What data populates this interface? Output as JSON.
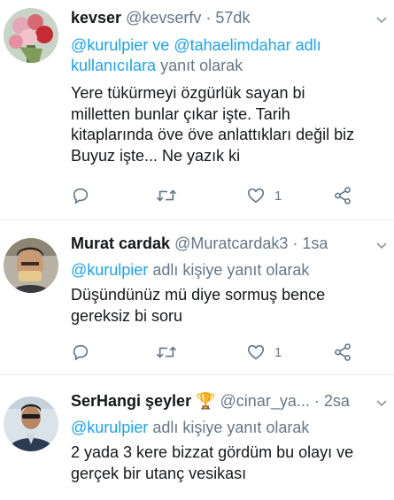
{
  "tweets": [
    {
      "name": "kevser",
      "handle": "@kevserfv",
      "separator": "·",
      "time": "57dk",
      "reply_mentions": "@kurulpier ve @tahaelimdahar adlı kullanıcılara",
      "reply_suffix": "yanıt olarak",
      "text_lines": [
        "Yere tükürmeyi özgürlük sayan bi",
        "milletten bunlar çıkar işte. Tarih",
        "kitaplarında öve öve anlattıkları değil biz",
        "Buyuz işte... Ne yazık ki"
      ],
      "like_count": "1",
      "avatar": "flower-bouquet"
    },
    {
      "name": "Murat cardak",
      "handle": "@Muratcardak3",
      "separator": "·",
      "time": "1sa",
      "reply_mentions": "@kurulpier",
      "reply_suffix": "adlı kişiye yanıt olarak",
      "text_lines": [
        "Düşündünüz mü diye sormuş bence",
        "gereksiz bi soru"
      ],
      "like_count": "1",
      "avatar": "man-portrait"
    },
    {
      "name": "SerHangi şeyler",
      "name_emoji": "🏆",
      "handle": "@cinar_ya...",
      "separator": "·",
      "time": "2sa",
      "reply_mentions": "@kurulpier",
      "reply_suffix": "adlı kişiye yanıt olarak",
      "text_lines": [
        "2 yada 3 kere bizzat gördüm bu olayı ve",
        "gerçek bir utanç vesikası"
      ],
      "avatar": "man-with-sunglasses"
    }
  ],
  "icons": {
    "reply": "reply-icon",
    "retweet": "retweet-icon",
    "like": "heart-icon",
    "share": "share-icon",
    "more": "chevron-down-icon"
  },
  "colors": {
    "text": "#14171a",
    "secondary": "#657786",
    "link": "#1da1f2",
    "divider": "#e6ecf0"
  }
}
